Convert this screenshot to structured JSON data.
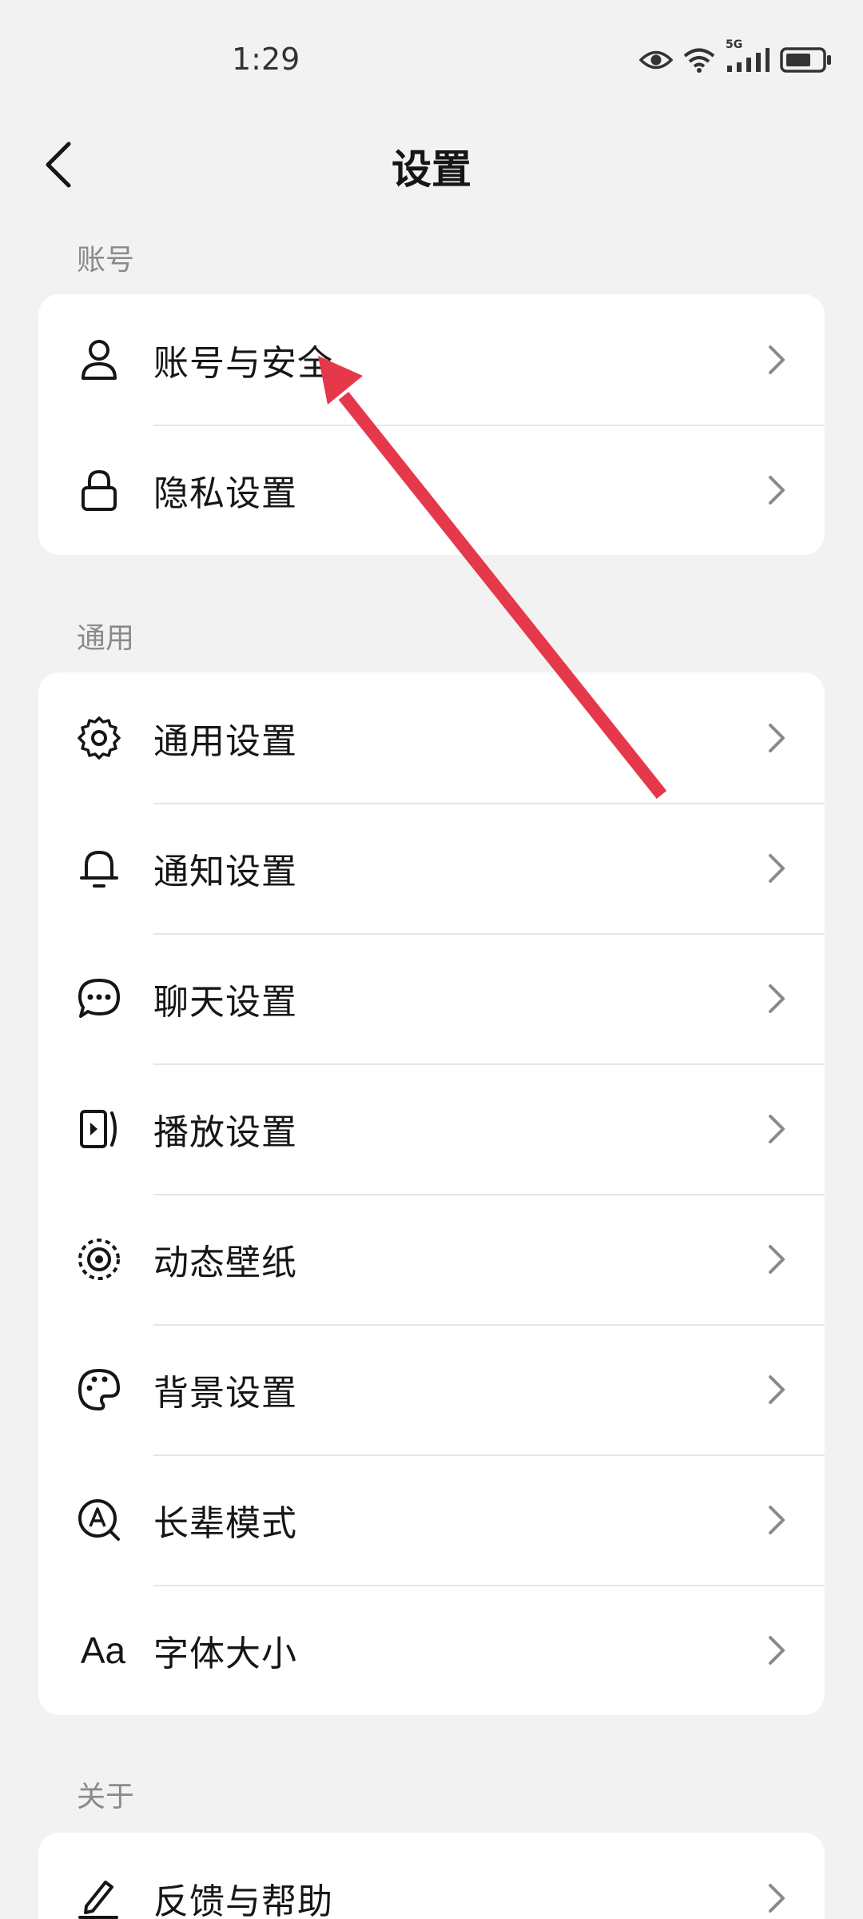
{
  "status_bar": {
    "time": "1:29",
    "network_label": "5G"
  },
  "header": {
    "title": "设置"
  },
  "sections": [
    {
      "label": "账号",
      "items": [
        {
          "label": "账号与安全",
          "icon": "user-icon"
        },
        {
          "label": "隐私设置",
          "icon": "lock-icon"
        }
      ]
    },
    {
      "label": "通用",
      "items": [
        {
          "label": "通用设置",
          "icon": "gear-icon"
        },
        {
          "label": "通知设置",
          "icon": "bell-icon"
        },
        {
          "label": "聊天设置",
          "icon": "chat-bubble-icon"
        },
        {
          "label": "播放设置",
          "icon": "play-icon"
        },
        {
          "label": "动态壁纸",
          "icon": "live-wallpaper-icon"
        },
        {
          "label": "背景设置",
          "icon": "palette-icon"
        },
        {
          "label": "长辈模式",
          "icon": "elder-mode-icon"
        },
        {
          "label": "字体大小",
          "icon": "font-size-icon",
          "icon_text": "Aa"
        }
      ]
    },
    {
      "label": "关于",
      "items": [
        {
          "label": "反馈与帮助",
          "icon": "pencil-icon"
        }
      ]
    }
  ],
  "annotation": {
    "arrow_color": "#e5384a"
  }
}
